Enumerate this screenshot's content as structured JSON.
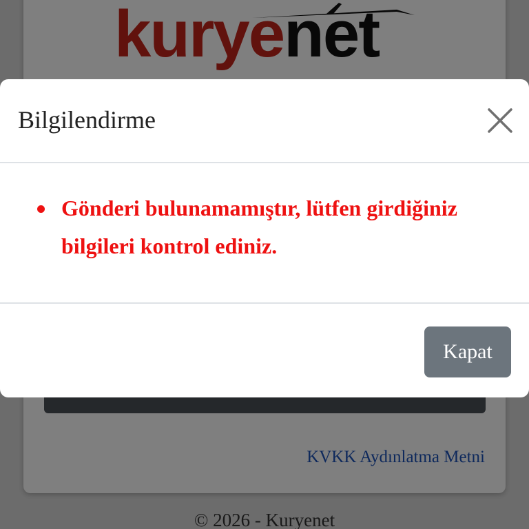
{
  "brand": {
    "logo_part1": "kurye",
    "logo_part2": "net",
    "logo_color_primary": "#c3251b",
    "logo_color_secondary": "#111111"
  },
  "page": {
    "kvkk_link": "KVKK Aydınlatma Metni",
    "footer": "© 2026 - Kuryenet"
  },
  "modal": {
    "title": "Bilgilendirme",
    "close_icon": "close-icon",
    "errors": [
      "Gönderi bulunamamıştır, lütfen girdiğiniz bilgileri kontrol ediniz."
    ],
    "error_color": "#ee1111",
    "close_button_label": "Kapat",
    "close_button_color": "#6c757d"
  }
}
